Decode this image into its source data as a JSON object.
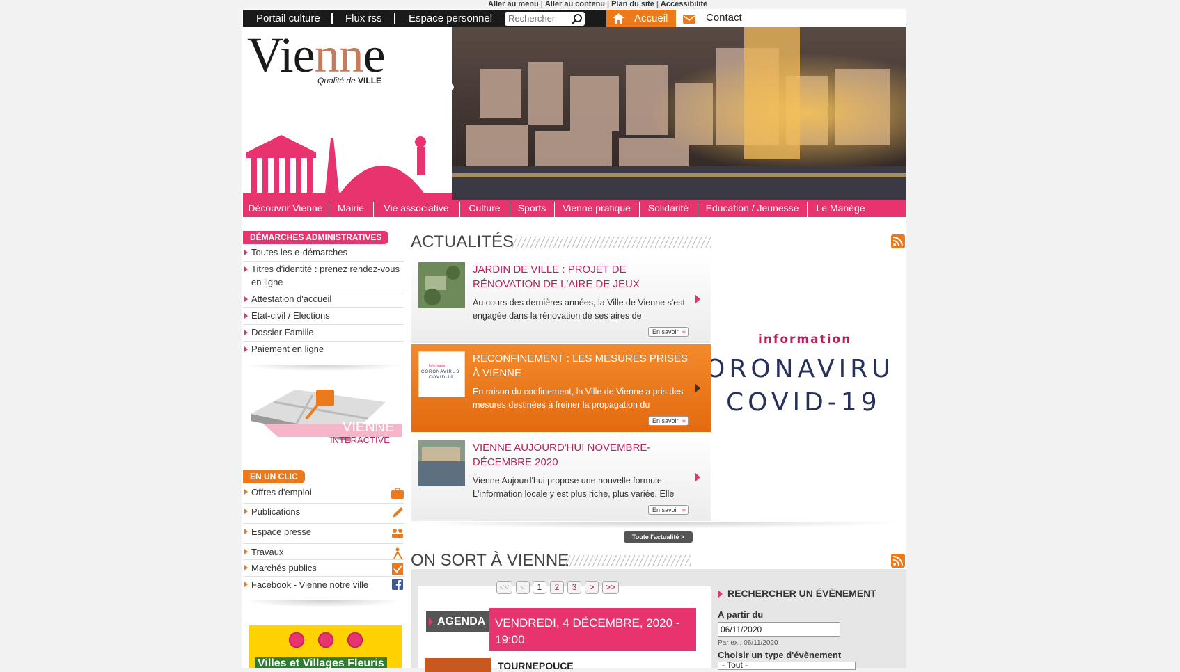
{
  "skip_links": [
    "Aller au menu",
    "Aller au contenu",
    "Plan du site",
    "Accessibilité"
  ],
  "topbar": {
    "links": [
      "Portail culture",
      "Flux rss",
      "Espace personnel"
    ],
    "search_placeholder": "Rechercher",
    "home_label": "Accueil",
    "contact_label": "Contact"
  },
  "logo": {
    "text_a": "Vie",
    "text_b": "nn",
    "text_c": "e",
    "tagline_a": "Qualité de ",
    "tagline_b": "VILLE"
  },
  "nav": [
    "Découvrir Vienne",
    "Mairie",
    "Vie associative",
    "Culture",
    "Sports",
    "Vienne pratique",
    "Solidarité",
    "Education / Jeunesse",
    "Le Manège"
  ],
  "demarches": {
    "title": "DÉMARCHES ADMINISTRATIVES",
    "items": [
      "Toutes les e-démarches",
      "Titres d'identité : prenez rendez-vous en ligne",
      "Attestation d'accueil",
      "Etat-civil / Elections",
      "Dossier Famille",
      "Paiement en ligne"
    ]
  },
  "vienne_interactive": {
    "line1": "VIENNE",
    "line2": "INTERACTIVE"
  },
  "en_un_clic": {
    "title": "EN UN CLIC",
    "items": [
      {
        "label": "Offres d'emploi",
        "icon": "briefcase-icon"
      },
      {
        "label": "Publications",
        "icon": "pencil-icon"
      },
      {
        "label": "Espace presse",
        "icon": "people-icon"
      },
      {
        "label": "Travaux",
        "icon": "worker-icon"
      },
      {
        "label": "Marchés publics",
        "icon": "checkbox-icon"
      },
      {
        "label": "Facebook - Vienne notre ville",
        "icon": "facebook-icon"
      }
    ]
  },
  "villes_fleuris": "Villes et Villages Fleuris",
  "actualites": {
    "title": "ACTUALITÉS",
    "items": [
      {
        "title": "JARDIN DE VILLE : PROJET DE RÉNOVATION DE L'AIRE DE JEUX",
        "text": "Au cours des dernières années, la Ville de Vienne s'est engagée dans la rénovation de ses aires de",
        "more": "En savoir"
      },
      {
        "title": "RECONFINEMENT : LES MESURES PRISES À VIENNE",
        "text": "En raison du confinement, la Ville de Vienne a pris des mesures destinées à freiner la propagation du",
        "more": "En savoir",
        "thumb_line1": "Information",
        "thumb_line2": "CORONAVIRUS",
        "thumb_line3": "COVID-19"
      },
      {
        "title": "VIENNE AUJOURD'HUI NOVEMBRE-DÉCEMBRE 2020",
        "text": "Vienne Aujourd'hui propose une nouvelle formule. L'information locale y est plus riche, plus variée. Elle",
        "more": "En savoir"
      }
    ],
    "all_label": "Toute l'actualité >"
  },
  "covid_banner": {
    "line1": "information",
    "line2": "ORONAVIRU",
    "line3": "COVID-19"
  },
  "sortir": {
    "title": "ON SORT À VIENNE",
    "pagination": [
      "<<",
      "<",
      "1",
      "2",
      "3",
      ">",
      ">>"
    ],
    "agenda_label": "AGENDA",
    "event_date": "VENDREDI, 4 DÉCEMBRE, 2020 - 19:00",
    "event_title": "TOURNEPOUCE",
    "search": {
      "title": "RECHERCHER UN ÉVÈNEMENT",
      "from_label": "A partir du",
      "from_value": "06/11/2020",
      "hint": "Par ex., 06/11/2020",
      "type_label": "Choisir un type d'évènement",
      "type_value": "- Tout -"
    }
  },
  "colors": {
    "pink": "#e8346e",
    "orange": "#ec7a1c",
    "dark": "#1a1a1a",
    "title_red": "#b4235d"
  }
}
